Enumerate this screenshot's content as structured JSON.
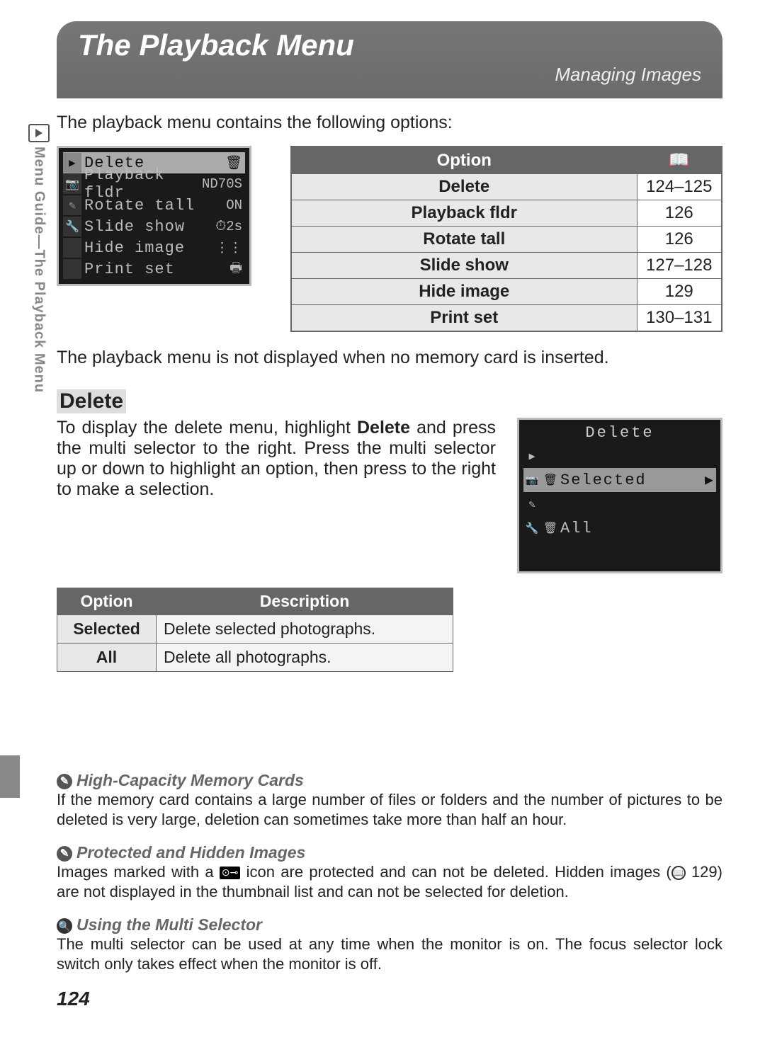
{
  "banner": {
    "title": "The Playback Menu",
    "subtitle": "Managing Images"
  },
  "side_label": "Menu Guide—The Playback Menu",
  "intro": "The playback menu contains the following options:",
  "lcd_menu": {
    "items": [
      {
        "label": "Delete",
        "value": "🗑"
      },
      {
        "label": "Playback fldr",
        "value": "ND70S"
      },
      {
        "label": "Rotate tall",
        "value": "ON"
      },
      {
        "label": "Slide show",
        "value": "⏱2s"
      },
      {
        "label": "Hide image",
        "value": "⋮⋮"
      },
      {
        "label": "Print set",
        "value": "🖶"
      }
    ]
  },
  "option_table": {
    "head_option": "Option",
    "head_page_icon": "📖",
    "rows": [
      {
        "option": "Delete",
        "page": "124–125"
      },
      {
        "option": "Playback fldr",
        "page": "126"
      },
      {
        "option": "Rotate tall",
        "page": "126"
      },
      {
        "option": "Slide show",
        "page": "127–128"
      },
      {
        "option": "Hide image",
        "page": "129"
      },
      {
        "option": "Print set",
        "page": "130–131"
      }
    ]
  },
  "below_note": "The playback menu is not displayed when no memory card is inserted.",
  "delete": {
    "heading": "Delete",
    "text_pre": "To display the delete menu, highlight ",
    "text_bold": "Delete",
    "text_post": " and press the multi selector to the right.  Press the multi selector up or down to highlight an option, then press to the right to make a selection.",
    "submenu_title": "Delete",
    "sub_items": [
      {
        "label": "Selected",
        "sel": true
      },
      {
        "label": "All",
        "sel": false
      }
    ],
    "table": {
      "h1": "Option",
      "h2": "Description",
      "rows": [
        {
          "o": "Selected",
          "d": "Delete selected photographs."
        },
        {
          "o": "All",
          "d": "Delete all photographs."
        }
      ]
    }
  },
  "notes": [
    {
      "icon": "✎",
      "title": "High-Capacity Memory Cards",
      "body": "If the memory card contains a large number of files or folders and the number of pictures to be deleted is very large, deletion can sometimes take more than half an hour."
    },
    {
      "icon": "✎",
      "title": "Protected and Hidden Images",
      "body_pre": "Images marked with a ",
      "body_key": "⊙⊸",
      "body_mid": " icon are protected and can not be deleted.  Hidden images (",
      "body_pgref": "129",
      "body_post": ") are not displayed in the thumbnail list and can not be selected for deletion."
    },
    {
      "icon": "🔍",
      "iconclass": "icq",
      "title": "Using the Multi Selector",
      "body": "The multi selector can be used at any time when the monitor is on.  The focus selector lock switch only takes effect when the monitor is off."
    }
  ],
  "page_number": "124"
}
